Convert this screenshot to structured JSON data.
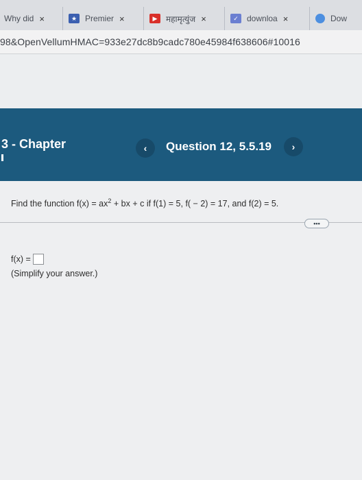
{
  "browser": {
    "tabs": [
      {
        "label": "Why did",
        "close": "×"
      },
      {
        "label": "Premier",
        "close": "×"
      },
      {
        "label": "महामृत्युंज",
        "close": "×"
      },
      {
        "label": "downloa",
        "close": "×"
      },
      {
        "label": "Dow",
        "close": ""
      }
    ],
    "url": "98&OpenVellumHMAC=933e27dc8b9cadc780e45984f638606#10016"
  },
  "header": {
    "chapter": "3 - Chapter",
    "prev_label": "‹",
    "next_label": "›",
    "question": "Question 12, 5.5.19"
  },
  "problem": {
    "prefix": "Find the function f(x) = ax",
    "exponent": "2",
    "suffix": " + bx + c if f(1) = 5, f( − 2) = 17, and f(2) = 5."
  },
  "more_label": "•••",
  "answer": {
    "label": "f(x) =",
    "value": "",
    "hint": "(Simplify your answer.)"
  },
  "colors": {
    "header_bg": "#1c5a7e",
    "nav_button_bg": "#174a69"
  }
}
